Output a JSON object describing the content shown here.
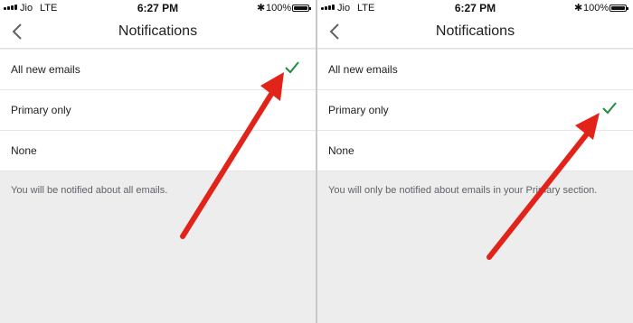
{
  "screens": [
    {
      "status": {
        "carrier": "Jio",
        "network": "LTE",
        "time": "6:27 PM",
        "battery": "100%"
      },
      "header": {
        "title": "Notifications"
      },
      "options": [
        {
          "label": "All new emails",
          "selected": true
        },
        {
          "label": "Primary only",
          "selected": false
        },
        {
          "label": "None",
          "selected": false
        }
      ],
      "description": "You will be notified about all emails."
    },
    {
      "status": {
        "carrier": "Jio",
        "network": "LTE",
        "time": "6:27 PM",
        "battery": "100%"
      },
      "header": {
        "title": "Notifications"
      },
      "options": [
        {
          "label": "All new emails",
          "selected": false
        },
        {
          "label": "Primary only",
          "selected": true
        },
        {
          "label": "None",
          "selected": false
        }
      ],
      "description": "You will only be notified about emails in your Primary section."
    }
  ],
  "colors": {
    "check": "#1e8e3e",
    "annotation_arrow": "#e2231a",
    "background": "#ededed"
  },
  "icons": {
    "back": "chevron-left-icon",
    "check": "checkmark-icon",
    "bluetooth": "bluetooth-icon",
    "battery": "battery-icon"
  }
}
